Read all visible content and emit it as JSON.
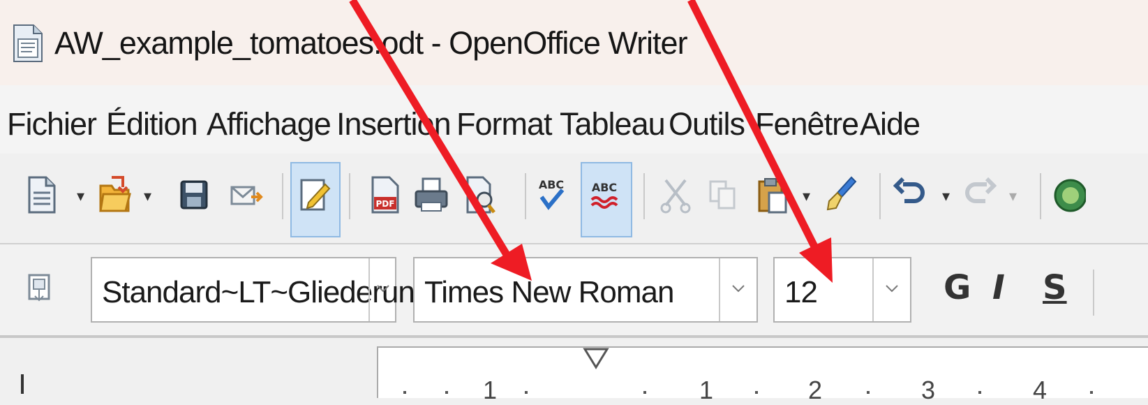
{
  "window": {
    "title": "AW_example_tomatoes.odt - OpenOffice Writer",
    "icon": "writer-document-icon"
  },
  "menubar": {
    "items": [
      {
        "label": "Fichier"
      },
      {
        "label": "Édition"
      },
      {
        "label": "Affichage"
      },
      {
        "label": "Insertion"
      },
      {
        "label": "Format"
      },
      {
        "label": "Tableau"
      },
      {
        "label": "Outils"
      },
      {
        "label": "Fenêtre"
      },
      {
        "label": "Aide"
      }
    ]
  },
  "standard_toolbar": {
    "icons": [
      "new-document-icon",
      "open-icon",
      "save-icon",
      "email-icon",
      "edit-mode-icon",
      "export-pdf-icon",
      "print-icon",
      "page-preview-icon",
      "spellcheck-icon",
      "autospellcheck-icon",
      "cut-icon",
      "copy-icon",
      "paste-icon",
      "format-paintbrush-icon",
      "undo-icon",
      "redo-icon",
      "navigator-icon"
    ],
    "active": [
      "edit-mode-icon",
      "autospellcheck-icon"
    ]
  },
  "formatting_toolbar": {
    "paragraph_style": "Standard~LT~Gliederun",
    "font_name": "Times New Roman",
    "font_size": "12",
    "bold_label": "G",
    "italic_label": "I",
    "underline_label": "S"
  },
  "ruler": {
    "numbers": [
      "1",
      "1",
      "2",
      "3",
      "4"
    ]
  },
  "annotation": {
    "arrow_color": "#ee1c24"
  }
}
